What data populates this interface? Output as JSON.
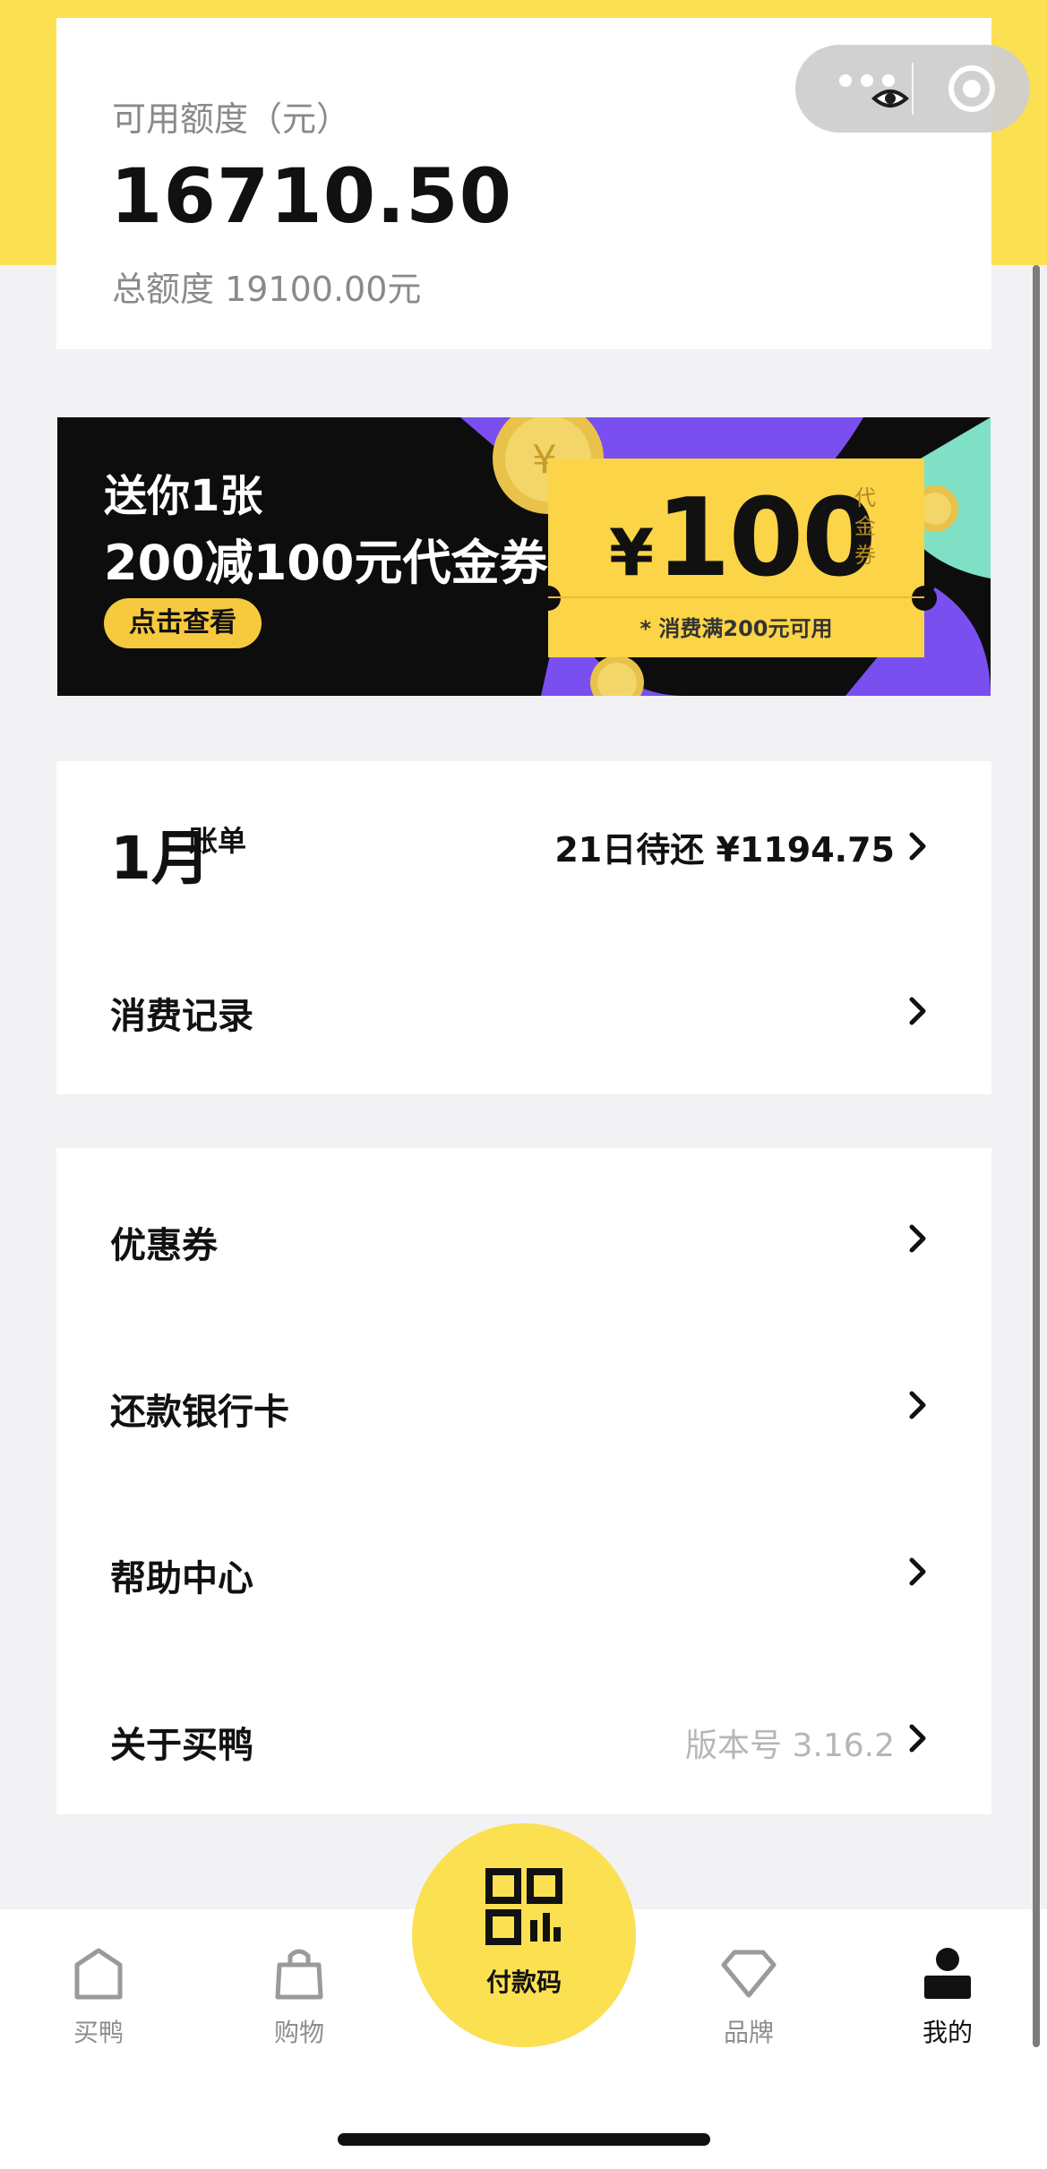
{
  "balance": {
    "label": "可用额度（元）",
    "value": "16710.50",
    "total": "总额度 19100.00元"
  },
  "capsule": {
    "more_icon": "more-dots-icon",
    "close_icon": "close-circle-icon"
  },
  "banner": {
    "line1": "送你1张",
    "line2": "200减100元代金券",
    "button": "点击查看",
    "coupon_currency": "¥",
    "coupon_amount": "100",
    "coupon_unit": "代金券",
    "coupon_condition": "* 消费满200元可用"
  },
  "bill": {
    "month": "1月",
    "month_suffix": "账单",
    "due": "21日待还  ¥1194.75"
  },
  "consumption": {
    "label": "消费记录"
  },
  "menu": [
    {
      "label": "优惠券",
      "extra": ""
    },
    {
      "label": "还款银行卡",
      "extra": ""
    },
    {
      "label": "帮助中心",
      "extra": ""
    },
    {
      "label": "关于买鸭",
      "extra": "版本号 3.16.2"
    }
  ],
  "tabs": [
    {
      "label": "买鸭",
      "icon": "home-icon",
      "active": false
    },
    {
      "label": "购物",
      "icon": "shopping-bag-icon",
      "active": false
    },
    {
      "label": "付款码",
      "icon": "qr-code-icon",
      "active": false
    },
    {
      "label": "品牌",
      "icon": "diamond-icon",
      "active": false
    },
    {
      "label": "我的",
      "icon": "user-icon",
      "active": true
    }
  ],
  "colors": {
    "brand_yellow": "#fbe052",
    "coupon_yellow": "#fbd447",
    "banner_bg": "#0d0d0d",
    "page_bg": "#f2f2f5"
  }
}
